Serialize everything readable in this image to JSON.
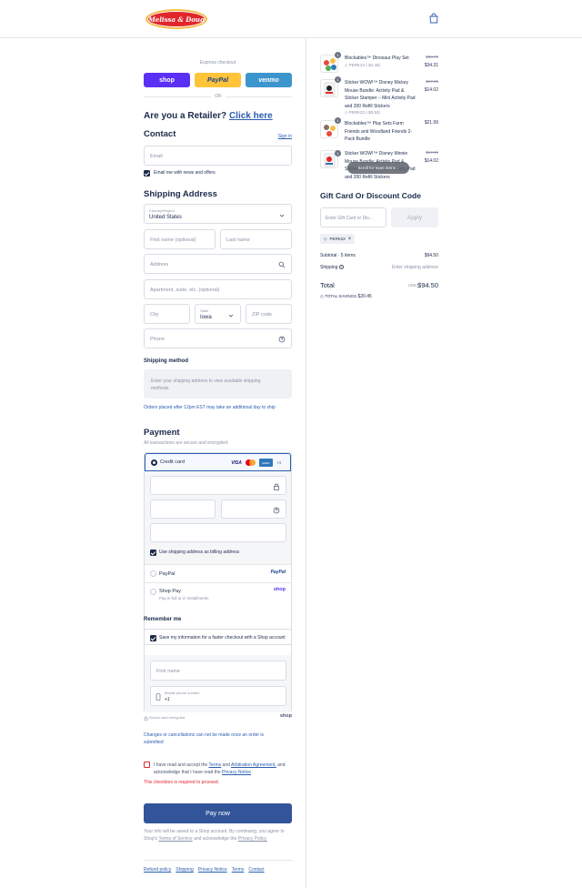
{
  "header": {
    "logo_text": "Melissa & Doug",
    "cart_icon": "shopping-bag-icon"
  },
  "express": {
    "label": "Express checkout",
    "shop": "shop",
    "paypal": "PayPal",
    "venmo": "venmo",
    "or": "OR"
  },
  "retailer": {
    "text": "Are you a Retailer?",
    "link": "Click here"
  },
  "contact": {
    "title": "Contact",
    "sign_in": "Sign in",
    "email_placeholder": "Email",
    "news_label": "Email me with news and offers"
  },
  "shipping": {
    "title": "Shipping Address",
    "country_label": "Country/Region",
    "country_value": "United States",
    "first_name": "First name (optional)",
    "last_name": "Last name",
    "address": "Address",
    "apartment": "Apartment, suite, etc. (optional)",
    "city": "City",
    "state_label": "State",
    "state_value": "Iowa",
    "zip": "ZIP code",
    "phone": "Phone"
  },
  "shipping_method": {
    "title": "Shipping method",
    "box_text": "Enter your shipping address to view available shipping methods.",
    "note": "Orders placed after 12pm EST may take an additional day to ship"
  },
  "payment": {
    "title": "Payment",
    "subtitle": "All transactions are secure and encrypted.",
    "credit_card": "Credit card",
    "visa": "VISA",
    "amex": "AMEX",
    "more_cards": "+4",
    "billing_label": "Use shipping address as billing address",
    "paypal": "PayPal",
    "paypal_logo": "PayPal",
    "shop_pay": "Shop Pay",
    "shop_pay_sub": "Pay in full or in installments",
    "shop_logo": "shop"
  },
  "remember": {
    "title": "Remember me",
    "save_label": "Save my information for a faster checkout with a Shop account",
    "first_name": "First name",
    "mobile_label": "Mobile phone number",
    "mobile_value": "+1",
    "secure": "Secure and encrypted",
    "shop": "shop"
  },
  "notes": {
    "changes": "Changes or cancellations can not be made once an order is submitted",
    "terms_1": "I have read and accept the",
    "terms_link": "Terms",
    "terms_and": "and",
    "arb_link": "Arbitration Agreement,",
    "terms_2": "and acknowledge that I have read the",
    "privacy_link": "Privacy Notice",
    "required": "This checkbox is required to proceed."
  },
  "pay_now": "Pay now",
  "shop_note": {
    "text1": "Your info will be saved to a Shop account. By continuing, you agree to Shop's",
    "tos": "Terms of Service",
    "text2": "and acknowledge the",
    "privacy": "Privacy Policy."
  },
  "footer": [
    "Refund policy",
    "Shipping",
    "Privacy Notice",
    "Terms",
    "Contact"
  ],
  "order": {
    "items": [
      {
        "qty": "1",
        "name": "Blockables™ Dinosaur Play Set",
        "tag": "PERK22 (-$4.48)",
        "old_price": "$38.79",
        "price": "$34.31"
      },
      {
        "qty": "1",
        "name": "Sticker WOW!™ Disney Mickey Mouse Bundle: Activity Pad & Sticker Stamper – Mini Activity Pad and 200 Refill Stickers",
        "tag": "PERK22 (-$3.92)",
        "old_price": "$17.99",
        "price": "$14.02"
      },
      {
        "qty": "1",
        "name": "Blockables™ Play Sets Farm Friends and Woodland Friends 2-Pack Bundle",
        "tag": "",
        "old_price": "",
        "price": "$21.99"
      },
      {
        "qty": "1",
        "name": "Sticker WOW!™ Disney Minnie Mouse Bundle: Activity Pad & Sticker Stamper – Mini Activity Pad and 200 Refill Stickers",
        "tag": "",
        "old_price": "$17.99",
        "price": "$14.02"
      }
    ],
    "scroll_hint": "Scroll for more items",
    "gift_title": "Gift Card Or Discount Code",
    "gift_placeholder": "Enter Gift Card or Dis...",
    "apply": "Apply",
    "code": "PERK22",
    "subtotal_label": "Subtotal · 5 items",
    "subtotal_value": "$94.50",
    "shipping_label": "Shipping",
    "shipping_value": "Enter shipping address",
    "total_label": "Total",
    "currency": "USD",
    "total_value": "$94.50",
    "savings_label": "TOTAL SAVINGS",
    "savings_value": "$20.45"
  }
}
